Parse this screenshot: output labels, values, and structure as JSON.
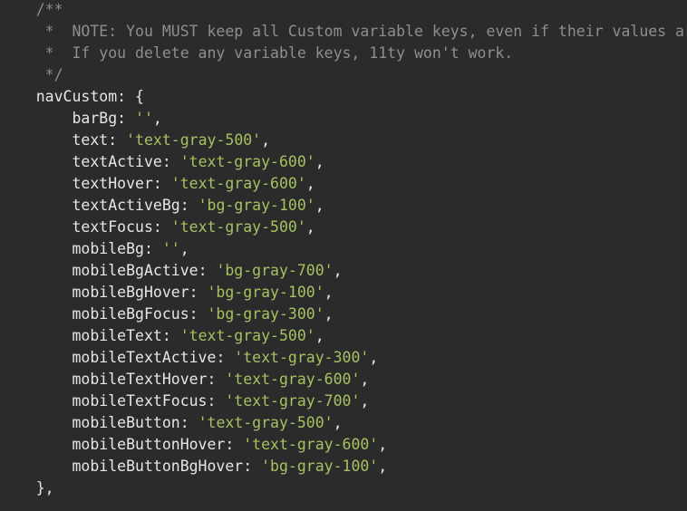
{
  "theme": {
    "background": "#2b2b2b",
    "text": "#e6e6e6",
    "comment": "#8e8e8e",
    "string": "#a5c261"
  },
  "comment": {
    "open": "/**",
    "line1": " *  NOTE: You MUST keep all Custom variable keys, even if their values are",
    "line2": " *  If you delete any variable keys, 11ty won't work.",
    "close": " */"
  },
  "object": {
    "name": "navCustom",
    "open": ": {",
    "close": "},"
  },
  "entries": [
    {
      "key": "barBg",
      "value": "''"
    },
    {
      "key": "text",
      "value": "'text-gray-500'"
    },
    {
      "key": "textActive",
      "value": "'text-gray-600'"
    },
    {
      "key": "textHover",
      "value": "'text-gray-600'"
    },
    {
      "key": "textActiveBg",
      "value": "'bg-gray-100'"
    },
    {
      "key": "textFocus",
      "value": "'text-gray-500'"
    },
    {
      "key": "mobileBg",
      "value": "''"
    },
    {
      "key": "mobileBgActive",
      "value": "'bg-gray-700'"
    },
    {
      "key": "mobileBgHover",
      "value": "'bg-gray-100'"
    },
    {
      "key": "mobileBgFocus",
      "value": "'bg-gray-300'"
    },
    {
      "key": "mobileText",
      "value": "'text-gray-500'"
    },
    {
      "key": "mobileTextActive",
      "value": "'text-gray-300'"
    },
    {
      "key": "mobileTextHover",
      "value": "'text-gray-600'"
    },
    {
      "key": "mobileTextFocus",
      "value": "'text-gray-700'"
    },
    {
      "key": "mobileButton",
      "value": "'text-gray-500'"
    },
    {
      "key": "mobileButtonHover",
      "value": "'text-gray-600'"
    },
    {
      "key": "mobileButtonBgHover",
      "value": "'bg-gray-100'"
    }
  ]
}
